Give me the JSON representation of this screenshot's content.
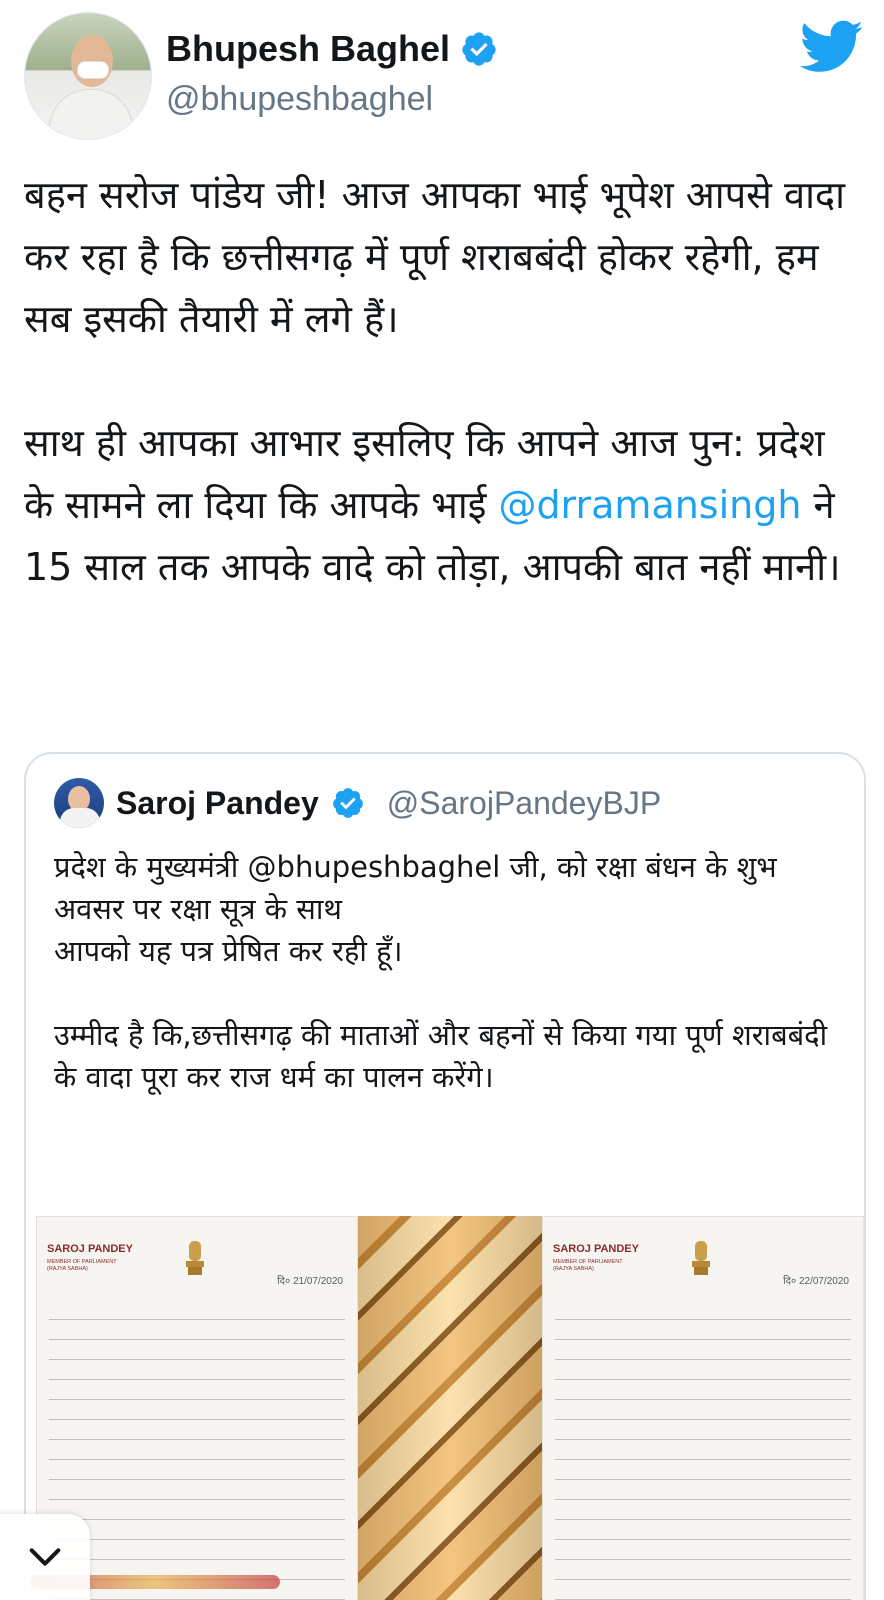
{
  "tweet": {
    "author": {
      "display_name": "Bhupesh Baghel",
      "handle": "@bhupeshbaghel",
      "verified": true
    },
    "brand_icon": "twitter-bird-icon",
    "text_part1": "बहन सरोज पांडेय जी! आज आपका भाई भूपेश आपसे वादा कर रहा है कि छत्तीसगढ़ में पूर्ण शराबबंदी होकर रहेगी, हम सब इसकी तैयारी में लगे हैं।\n\nसाथ ही आपका आभार इसलिए कि आपने आज पुन: प्रदेश के सामने ला दिया कि आपके भाई ",
    "mention": "@drramansingh",
    "text_part2": " ने 15 साल तक आपके वादे को तोड़ा, आपकी बात नहीं मानी।"
  },
  "quoted_tweet": {
    "author": {
      "display_name": "Saroj Pandey",
      "handle": "@SarojPandeyBJP",
      "verified": true
    },
    "text": "प्रदेश के मुख्यमंत्री @bhupeshbaghel जी, को रक्षा बंधन के शुभ अवसर पर रक्षा सूत्र के साथ\nआपको यह पत्र प्रेषित कर रही हूँ।\n\nउम्मीद है कि,छत्तीसगढ़ की माताओं और बहनों से किया गया पूर्ण शराबबंदी के वादा पूरा कर राज धर्म का पालन करेंगे।",
    "images": {
      "letter_left": {
        "header_name": "SAROJ PANDEY",
        "header_sub": "MEMBER OF PARLIAMENT\n(RAJYA SABHA)",
        "date": "दि० 21/07/2020"
      },
      "letter_right": {
        "header_name": "SAROJ PANDEY",
        "header_sub": "MEMBER OF PARLIAMENT\n(RAJYA SABHA)",
        "date": "दि० 22/07/2020"
      }
    }
  },
  "colors": {
    "link": "#1da1f2",
    "verified": "#1da1f2",
    "secondary_text": "#657786",
    "primary_text": "#14171a"
  }
}
